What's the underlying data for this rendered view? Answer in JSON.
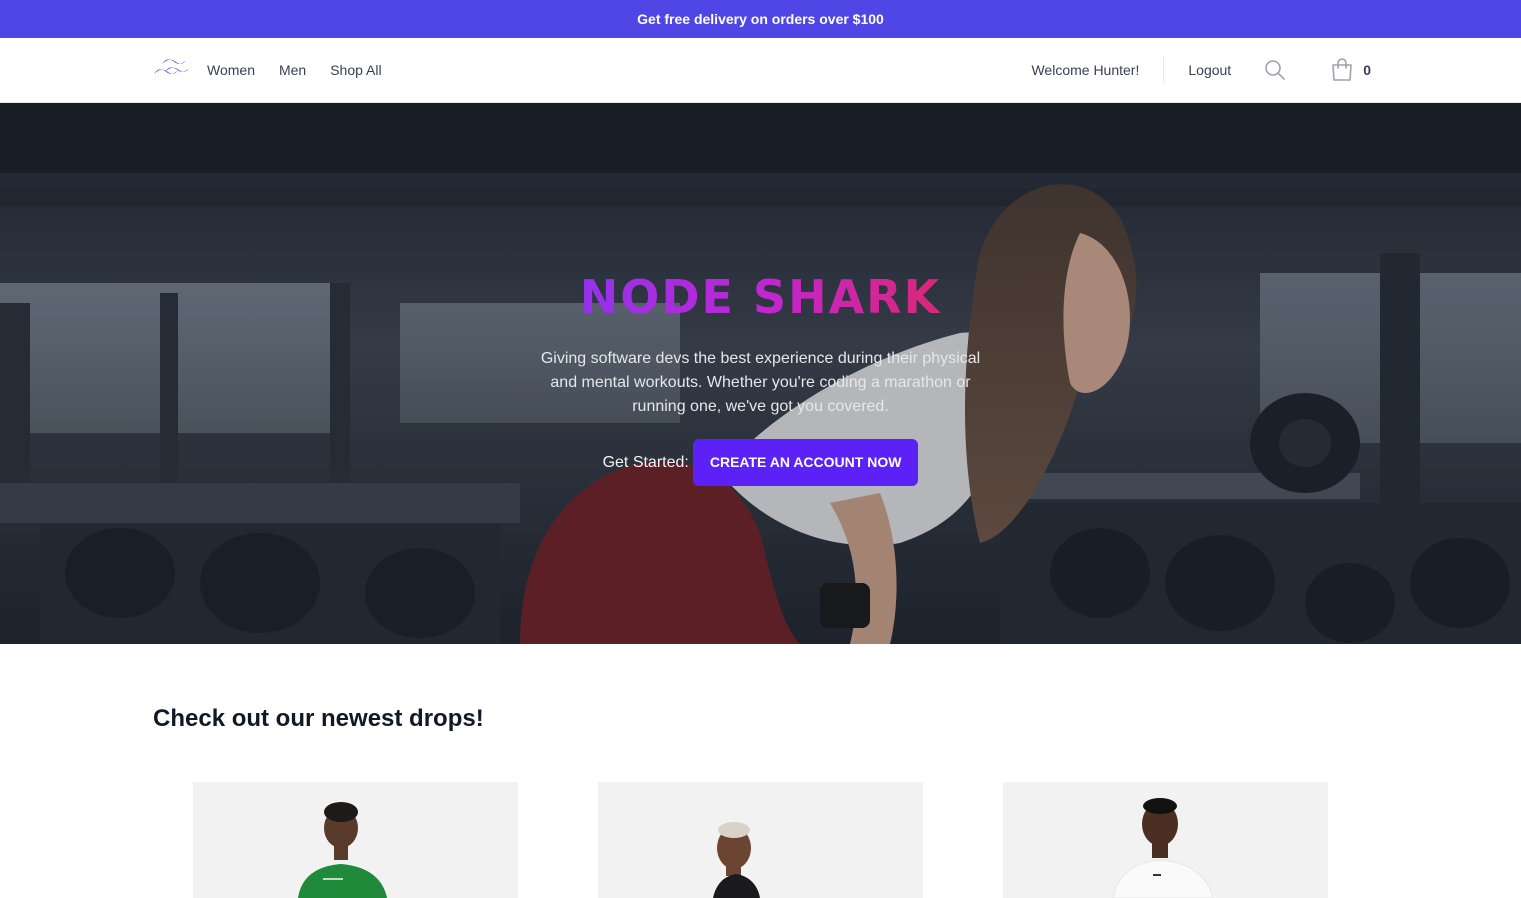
{
  "promo": {
    "text": "Get free delivery on orders over $100"
  },
  "nav": {
    "logo_icon": "tailwind-wave-logo",
    "links": [
      "Women",
      "Men",
      "Shop All"
    ],
    "welcome": "Welcome Hunter!",
    "logout": "Logout",
    "search_icon": "search-icon",
    "cart_icon": "shopping-bag-icon",
    "cart_count": "0"
  },
  "hero": {
    "title": "NODE SHARK",
    "subtitle": "Giving software devs the best experience during their physical and mental workouts. Whether you're coding a marathon or running one, we've got you covered.",
    "cta_label": "Get Started:",
    "cta_button": "CREATE AN ACCOUNT NOW"
  },
  "products": {
    "heading": "Check out our newest drops!",
    "items": [
      {
        "image": "woman-green-top"
      },
      {
        "image": "man-black-shirt"
      },
      {
        "image": "man-white-shirt"
      }
    ]
  },
  "colors": {
    "accent": "#4f46e5",
    "cta": "#5b21f6",
    "title_gradient": [
      "#9333ea",
      "#db2777"
    ]
  }
}
